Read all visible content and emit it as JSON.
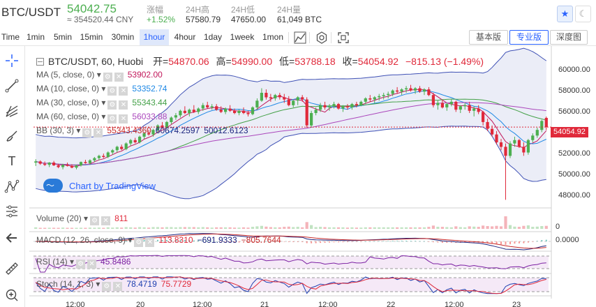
{
  "header": {
    "pair": "BTC/USDT",
    "last_price": "54042.75",
    "cny_price": "≈ 354520.44 CNY",
    "stats": [
      {
        "key": "涨幅",
        "value": "+1.52%",
        "color": "#4caf50"
      },
      {
        "key": "24H高",
        "value": "57580.79",
        "color": "#333333"
      },
      {
        "key": "24H低",
        "value": "47650.00",
        "color": "#333333"
      },
      {
        "key": "24H量",
        "value": "61,049 BTC",
        "color": "#333333"
      }
    ],
    "star_icon": "star-icon",
    "theme_icon": "moon-icon"
  },
  "toolbar": {
    "timeframes": [
      "Time",
      "1min",
      "5min",
      "15min",
      "30min",
      "1hour",
      "4hour",
      "1day",
      "1week",
      "1mon"
    ],
    "active_timeframe": "1hour",
    "icons": [
      "candlestick-type-icon",
      "settings-icon",
      "fullscreen-icon"
    ],
    "views": [
      "基本版",
      "专业版",
      "深度图"
    ],
    "active_view": "专业版"
  },
  "left_tools": [
    "crosshair-icon",
    "trendline-icon",
    "pitchfork-icon",
    "brush-icon",
    "text-icon",
    "pattern-icon",
    "measure-icon",
    "back-arrow-icon",
    "ruler-icon",
    "zoom-in-icon"
  ],
  "legend": {
    "ohlc": {
      "symbol": "BTC/USDT, 60, Huobi",
      "open_label": "开=",
      "open": "54870.06",
      "high_label": "高=",
      "high": "54990.00",
      "low_label": "低=",
      "low": "53788.18",
      "close_label": "收=",
      "close": "54054.92",
      "change": "−815.13 (−1.49%)"
    },
    "indicators": [
      {
        "label": "MA (5, close, 0)",
        "value": "53902.00",
        "color": "#c2185b"
      },
      {
        "label": "MA (10, close, 0)",
        "value": "53352.74",
        "color": "#1e88e5"
      },
      {
        "label": "MA (30, close, 0)",
        "value": "55343.44",
        "color": "#43a047"
      },
      {
        "label": "MA (60, close, 0)",
        "value": "56033.88",
        "color": "#ab47bc"
      },
      {
        "label": "BB (30, 3)",
        "value": "55343.4360",
        "value2": "60674.2597",
        "value3": "50012.6123",
        "color": "#c62828"
      }
    ],
    "volume": {
      "label": "Volume (20)",
      "value": "811"
    },
    "macd": {
      "label": "MACD (12, 26, close, 9)",
      "v1": "113.8310",
      "v2": "−691.9333",
      "v3": "−805.7644"
    },
    "rsi": {
      "label": "RSI (14)",
      "value": "45.8486"
    },
    "stoch": {
      "label": "Stoch (14, 1, 3)",
      "v1": "78.4719",
      "v2": "75.7729"
    }
  },
  "watermark": "Chart by TradingView",
  "price_axis": [
    "60000.00",
    "58000.00",
    "56000.00",
    "52000.00",
    "50000.00",
    "48000.00"
  ],
  "current_price_label": "54054.92",
  "macd_axis": "0.0000",
  "volume_axis": "0",
  "time_axis": [
    "12:00",
    "20",
    "12:00",
    "21",
    "12:00",
    "22",
    "12:00",
    "23"
  ],
  "colors": {
    "up": "#4caf50",
    "down": "#e0293a",
    "accent": "#2962ff",
    "bb": "#3f51b5"
  },
  "chart_data": {
    "type": "candlestick",
    "timeframe": "1hour",
    "symbol": "BTC/USDT",
    "ylim": [
      47000,
      61000
    ],
    "candles": [
      [
        50900,
        51200,
        50600,
        51000
      ],
      [
        51000,
        51100,
        50700,
        50800
      ],
      [
        50800,
        51000,
        50600,
        50700
      ],
      [
        50700,
        50950,
        50500,
        50900
      ],
      [
        50900,
        51050,
        50600,
        50650
      ],
      [
        50650,
        50800,
        50400,
        50500
      ],
      [
        50500,
        50800,
        50300,
        50700
      ],
      [
        50700,
        50900,
        50550,
        50600
      ],
      [
        50600,
        50750,
        50400,
        50450
      ],
      [
        50450,
        50700,
        50300,
        50650
      ],
      [
        50650,
        51000,
        50550,
        50950
      ],
      [
        50950,
        51150,
        50800,
        50850
      ],
      [
        50850,
        51200,
        50700,
        51100
      ],
      [
        51100,
        51400,
        50950,
        51300
      ],
      [
        51300,
        51600,
        51100,
        51500
      ],
      [
        51500,
        51700,
        51300,
        51400
      ],
      [
        51400,
        51900,
        51300,
        51800
      ],
      [
        51800,
        52100,
        51600,
        52000
      ],
      [
        52000,
        52400,
        51800,
        52300
      ],
      [
        52300,
        52500,
        52000,
        52100
      ],
      [
        52100,
        52700,
        52000,
        52600
      ],
      [
        52600,
        53000,
        52400,
        52900
      ],
      [
        52900,
        53100,
        52600,
        52700
      ],
      [
        52700,
        53300,
        52600,
        53200
      ],
      [
        53200,
        53600,
        53000,
        53500
      ],
      [
        53500,
        53800,
        53300,
        53400
      ],
      [
        53400,
        53900,
        53200,
        53800
      ],
      [
        53800,
        54300,
        53600,
        54200
      ],
      [
        54200,
        54500,
        53900,
        54000
      ],
      [
        54000,
        54600,
        53900,
        54500
      ],
      [
        54500,
        55000,
        54300,
        54900
      ],
      [
        54900,
        55300,
        54700,
        55100
      ],
      [
        55100,
        55600,
        54900,
        55500
      ],
      [
        55500,
        55900,
        55200,
        55300
      ],
      [
        55300,
        55700,
        55000,
        55600
      ],
      [
        55600,
        56000,
        55300,
        55400
      ],
      [
        55400,
        55800,
        55200,
        55700
      ],
      [
        55700,
        56200,
        55500,
        56000
      ],
      [
        56000,
        56300,
        55700,
        55800
      ],
      [
        55800,
        56100,
        55600,
        55900
      ],
      [
        55900,
        56100,
        55500,
        55600
      ],
      [
        55600,
        55900,
        55300,
        55400
      ],
      [
        55400,
        55800,
        55200,
        55700
      ],
      [
        55700,
        56000,
        55400,
        55500
      ],
      [
        55500,
        55700,
        55200,
        55300
      ],
      [
        55300,
        55600,
        55100,
        55500
      ],
      [
        55500,
        55800,
        55200,
        55300
      ],
      [
        55300,
        55500,
        55000,
        55200
      ],
      [
        55200,
        55900,
        55100,
        55800
      ],
      [
        55800,
        56600,
        55600,
        56400
      ],
      [
        56400,
        57500,
        56300,
        57100
      ],
      [
        57100,
        57400,
        56500,
        56700
      ],
      [
        56700,
        57000,
        56300,
        56600
      ],
      [
        56600,
        57000,
        56400,
        56900
      ],
      [
        56900,
        57100,
        56500,
        56700
      ],
      [
        56700,
        57000,
        56200,
        56500
      ],
      [
        56500,
        56800,
        55900,
        56000
      ],
      [
        56000,
        56500,
        55800,
        56400
      ],
      [
        56400,
        56800,
        56000,
        56700
      ],
      [
        56700,
        56900,
        56300,
        56500
      ],
      [
        56500,
        56700,
        54000,
        54200
      ],
      [
        54200,
        55500,
        54000,
        55300
      ],
      [
        55300,
        55800,
        55100,
        55600
      ],
      [
        55600,
        56200,
        55400,
        56000
      ],
      [
        56000,
        56300,
        55600,
        55800
      ],
      [
        55800,
        56100,
        55500,
        55900
      ],
      [
        55900,
        56300,
        55700,
        56100
      ],
      [
        56100,
        56200,
        55600,
        55700
      ],
      [
        55700,
        56000,
        55400,
        55900
      ],
      [
        55900,
        56100,
        55600,
        55800
      ],
      [
        55800,
        56200,
        55600,
        56100
      ],
      [
        56100,
        56300,
        55800,
        56000
      ],
      [
        56000,
        56400,
        55900,
        56300
      ],
      [
        56300,
        56700,
        56100,
        56600
      ],
      [
        56600,
        56900,
        56300,
        56500
      ],
      [
        56500,
        56800,
        56200,
        56700
      ],
      [
        56700,
        57000,
        56400,
        56800
      ],
      [
        56800,
        57100,
        56500,
        56900
      ],
      [
        56900,
        57200,
        56600,
        57000
      ],
      [
        57000,
        57400,
        56800,
        57300
      ],
      [
        57300,
        57600,
        57000,
        57200
      ],
      [
        57200,
        57500,
        56900,
        57400
      ],
      [
        57400,
        57700,
        57100,
        57500
      ],
      [
        57500,
        57800,
        57200,
        57300
      ],
      [
        57300,
        57600,
        57000,
        57500
      ],
      [
        57500,
        57700,
        57100,
        57200
      ],
      [
        57200,
        57500,
        56900,
        57400
      ],
      [
        57400,
        57600,
        56800,
        56900
      ],
      [
        56900,
        57100,
        55800,
        56000
      ],
      [
        56000,
        56400,
        55600,
        56200
      ],
      [
        56200,
        56500,
        55700,
        55800
      ],
      [
        55800,
        56200,
        55500,
        56100
      ],
      [
        56100,
        56500,
        55900,
        56300
      ],
      [
        56300,
        56400,
        55400,
        55600
      ],
      [
        55600,
        56000,
        55300,
        55900
      ],
      [
        55900,
        56200,
        55600,
        56000
      ],
      [
        56000,
        56300,
        55300,
        55500
      ],
      [
        55500,
        55900,
        55000,
        55700
      ],
      [
        55700,
        56000,
        55200,
        55400
      ],
      [
        55400,
        55500,
        54200,
        54500
      ],
      [
        54500,
        54800,
        53700,
        53900
      ],
      [
        53900,
        54200,
        53200,
        53400
      ],
      [
        53400,
        53700,
        52500,
        52700
      ],
      [
        52700,
        53000,
        52000,
        52300
      ],
      [
        52300,
        52600,
        47600,
        51500
      ],
      [
        51500,
        52800,
        51300,
        52600
      ],
      [
        52600,
        53200,
        52300,
        52900
      ],
      [
        52900,
        53000,
        52200,
        52300
      ],
      [
        52300,
        52700,
        51500,
        51800
      ],
      [
        51800,
        53000,
        51600,
        52900
      ],
      [
        52900,
        53500,
        52700,
        53300
      ],
      [
        53300,
        54000,
        53100,
        53800
      ],
      [
        53800,
        54700,
        53600,
        54600
      ],
      [
        54870,
        54990,
        53788,
        54054
      ]
    ]
  }
}
